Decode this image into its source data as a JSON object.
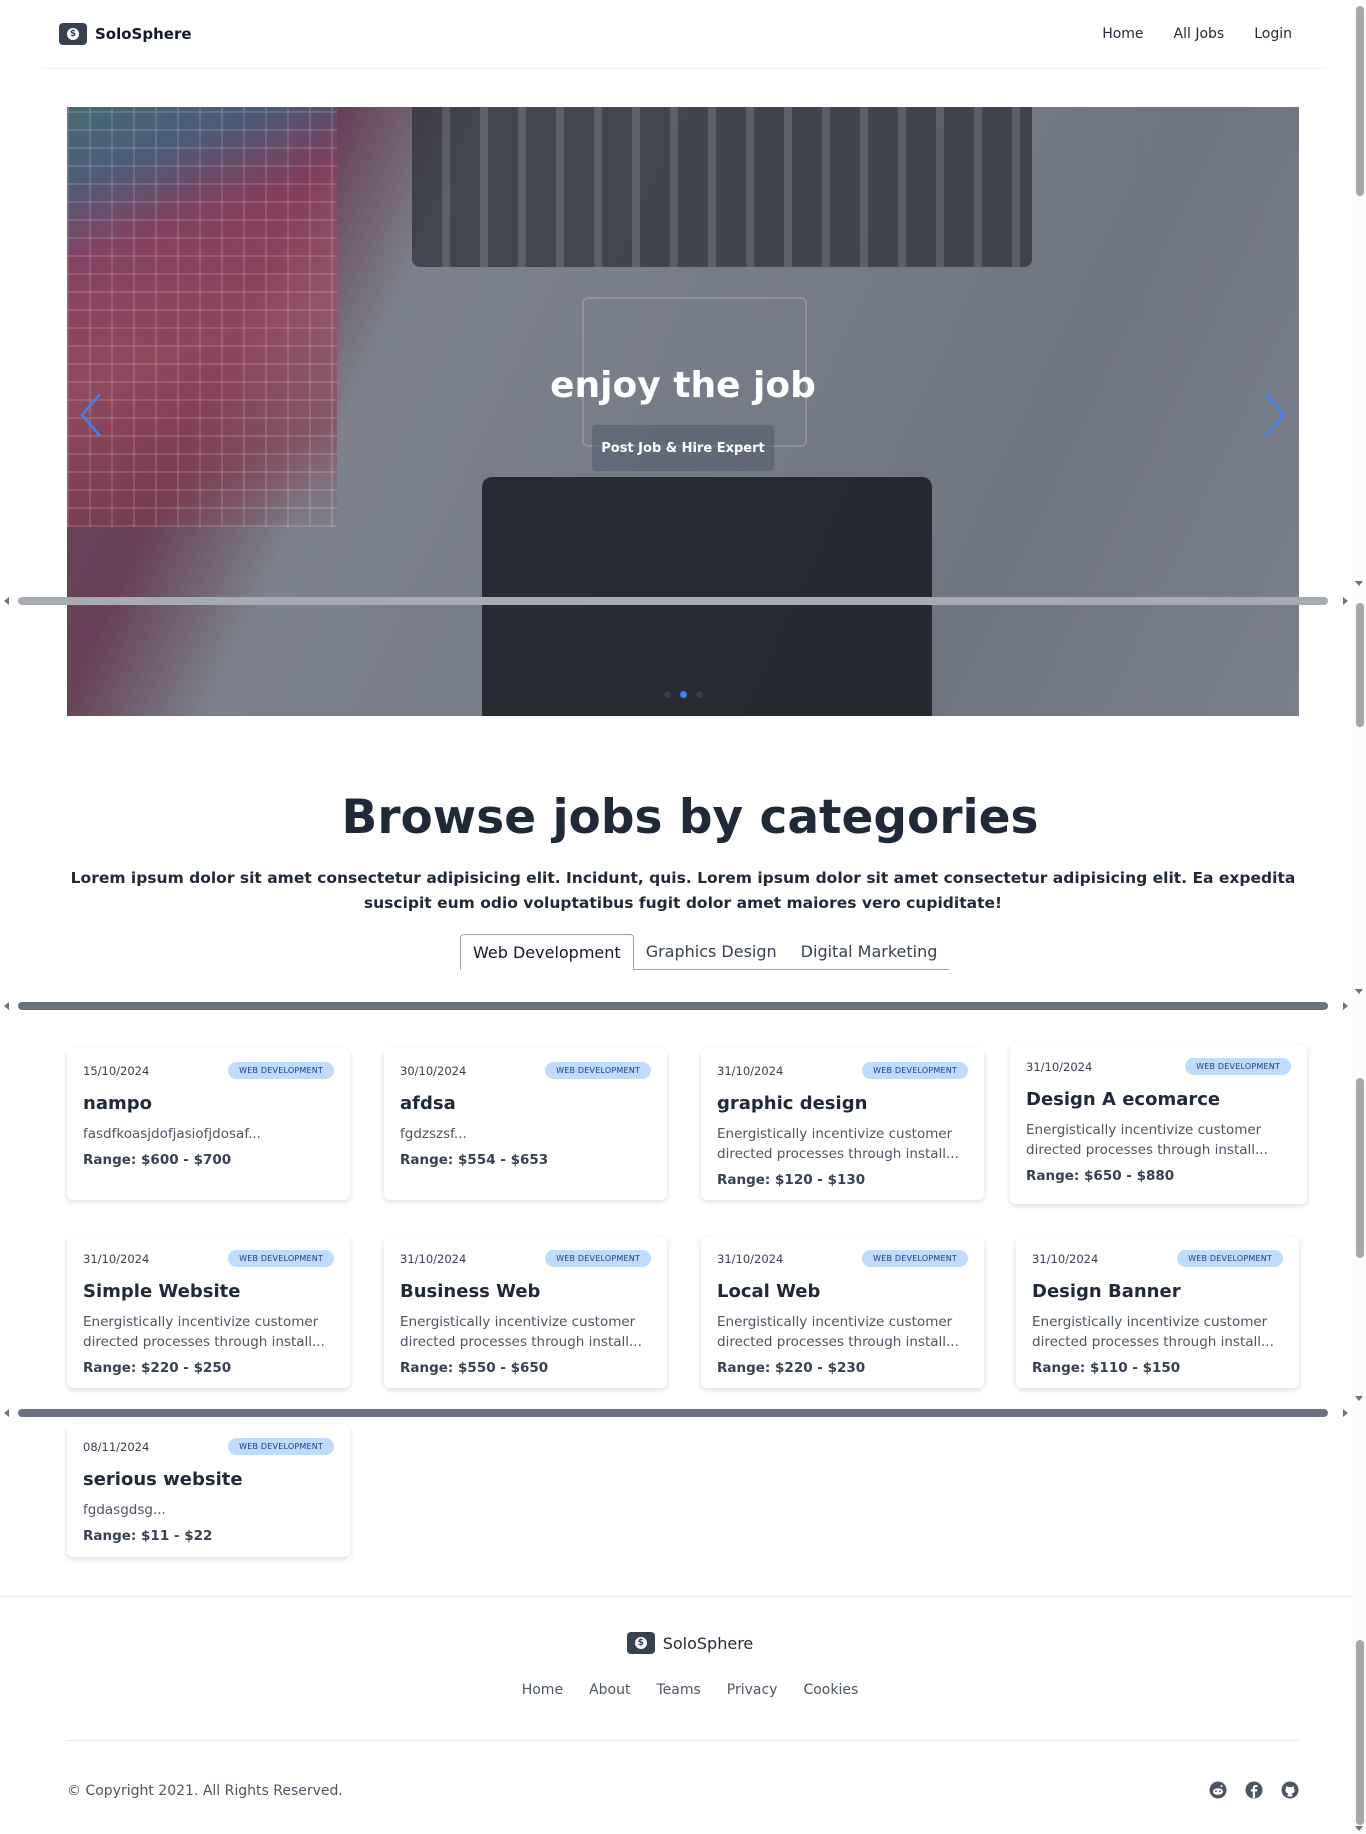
{
  "navbar": {
    "brand": "SoloSphere",
    "links": [
      "Home",
      "All Jobs",
      "Login"
    ]
  },
  "hero": {
    "title": "enjoy the job",
    "cta": "Post Job & Hire Expert",
    "slides_total": 3,
    "active_slide": 2
  },
  "categories": {
    "title": "Browse jobs by categories",
    "description": "Lorem ipsum dolor sit amet consectetur adipisicing elit. Incidunt, quis. Lorem ipsum dolor sit amet consectetur adipisicing elit. Ea expedita suscipit eum odio voluptatibus fugit dolor amet maiores vero cupiditate!",
    "tabs": [
      "Web Development",
      "Graphics Design",
      "Digital Marketing"
    ],
    "active_tab": "Web Development"
  },
  "jobs": [
    {
      "date": "15/10/2024",
      "badge": "WEB DEVELOPMENT",
      "title": "nampo",
      "desc": "fasdfkoasjdofjasiofjdosaf...",
      "range": "Range: $600 - $700"
    },
    {
      "date": "30/10/2024",
      "badge": "WEB DEVELOPMENT",
      "title": "afdsa",
      "desc": "fgdzszsf...",
      "range": "Range: $554 - $653"
    },
    {
      "date": "31/10/2024",
      "badge": "WEB DEVELOPMENT",
      "title": "graphic design",
      "desc": "Energistically incentivize customer directed processes through install...",
      "range": "Range: $120 - $130"
    },
    {
      "date": "31/10/2024",
      "badge": "WEB DEVELOPMENT",
      "title": "Design A ecomarce",
      "desc": "Energistically incentivize customer directed processes through install...",
      "range": "Range: $650 - $880"
    },
    {
      "date": "31/10/2024",
      "badge": "WEB DEVELOPMENT",
      "title": "Simple Website",
      "desc": "Energistically incentivize customer directed processes through install...",
      "range": "Range: $220 - $250"
    },
    {
      "date": "31/10/2024",
      "badge": "WEB DEVELOPMENT",
      "title": "Business Web",
      "desc": "Energistically incentivize customer directed processes through install...",
      "range": "Range: $550 - $650"
    },
    {
      "date": "31/10/2024",
      "badge": "WEB DEVELOPMENT",
      "title": "Local Web",
      "desc": "Energistically incentivize customer directed processes through install...",
      "range": "Range: $220 - $230"
    },
    {
      "date": "31/10/2024",
      "badge": "WEB DEVELOPMENT",
      "title": "Design Banner",
      "desc": "Energistically incentivize customer directed processes through install...",
      "range": "Range: $110 - $150"
    },
    {
      "date": "08/11/2024",
      "badge": "WEB DEVELOPMENT",
      "title": "serious website",
      "desc": "fgdasgdsg...",
      "range": "Range: $11 - $22"
    }
  ],
  "footer": {
    "brand": "SoloSphere",
    "links": [
      "Home",
      "About",
      "Teams",
      "Privacy",
      "Cookies"
    ],
    "copyright": "© Copyright 2021. All Rights Reserved.",
    "social_icons": [
      "reddit-icon",
      "facebook-icon",
      "github-icon"
    ]
  },
  "colors": {
    "accent": "#3b82f6",
    "badge_bg": "#bfdbfe",
    "badge_text": "#1e3a8a",
    "text_dark": "#1f2937"
  }
}
